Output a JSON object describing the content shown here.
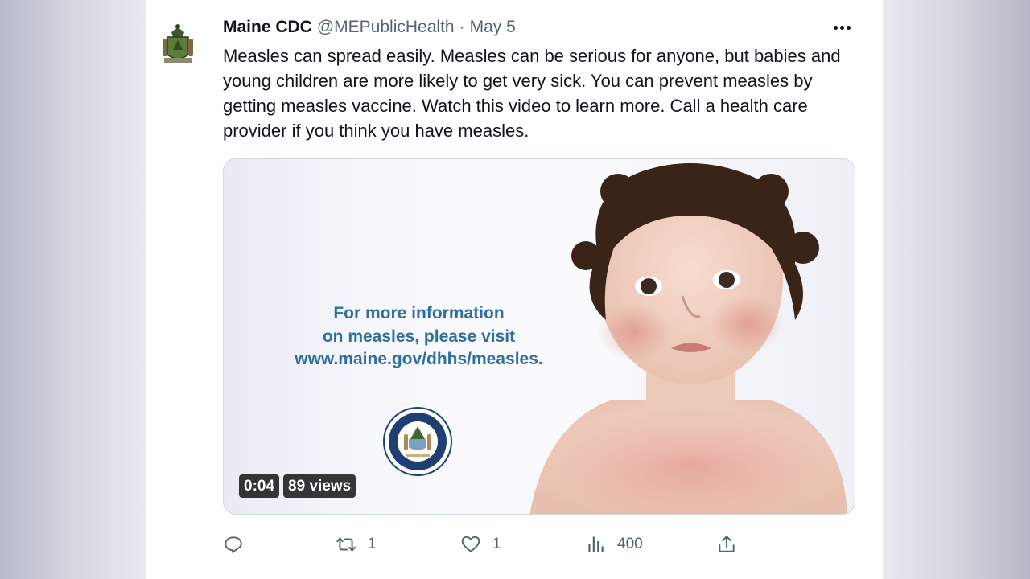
{
  "tweet": {
    "author_name": "Maine CDC",
    "handle": "@MEPublicHealth",
    "separator": "·",
    "date": "May 5",
    "text": "Measles can spread easily. Measles can be serious for anyone, but babies and young children are more likely to get very sick. You can prevent measles by getting measles vaccine. Watch this video to learn more. Call a health care provider if you think you have measles.",
    "more_icon": "more-horizontal-icon",
    "media": {
      "info_line1": "For more information",
      "info_line2": "on measles, please visit",
      "info_url": "www.maine.gov/dhhs/measles.",
      "duration": "0:04",
      "views": "89 views",
      "seal_caption": "Department of Health and Human Services"
    },
    "actions": {
      "reply_icon": "reply-icon",
      "reply_count": "",
      "retweet_icon": "retweet-icon",
      "retweet_count": "1",
      "like_icon": "heart-icon",
      "like_count": "1",
      "views_icon": "analytics-icon",
      "views_count": "400",
      "share_icon": "share-icon"
    }
  },
  "colors": {
    "text": "#0f1419",
    "secondary": "#536471",
    "info_blue": "#2f6f9e",
    "border": "#cfd9de"
  }
}
